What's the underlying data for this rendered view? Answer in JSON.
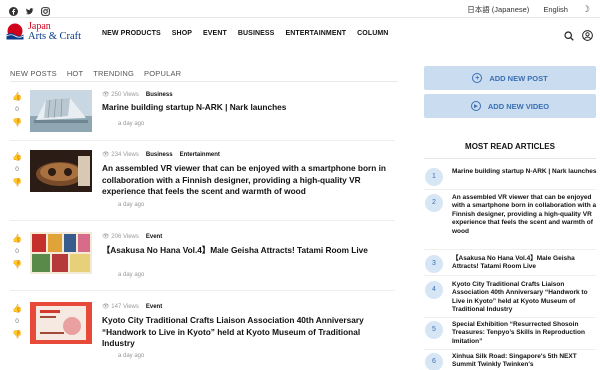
{
  "topbar": {
    "social_icons": [
      "facebook-icon",
      "twitter-icon",
      "instagram-icon"
    ],
    "lang_jp": "日本語 (Japanese)",
    "lang_en": "English"
  },
  "header": {
    "logo_line1": "Japan",
    "logo_line2": "Arts & Craft",
    "nav": [
      "NEW PRODUCTS",
      "SHOP",
      "EVENT",
      "BUSINESS",
      "ENTERTAINMENT",
      "COLUMN"
    ]
  },
  "tabs": [
    "NEW POSTS",
    "HOT",
    "TRENDING",
    "POPULAR"
  ],
  "articles": [
    {
      "votes": "0",
      "views": "250 Views",
      "cats": [
        "Business"
      ],
      "title": "Marine building startup N-ARK | Nark launches",
      "ago": "a day ago"
    },
    {
      "votes": "0",
      "views": "234 Views",
      "cats": [
        "Business",
        "Entertainment"
      ],
      "title": "An assembled VR viewer that can be enjoyed with a smartphone born in collaboration with a Finnish designer, providing a high-quality VR experience that feels the scent and warmth of wood",
      "ago": "a day ago"
    },
    {
      "votes": "0",
      "views": "206 Views",
      "cats": [
        "Event"
      ],
      "title": "【Asakusa No Hana Vol.4】Male Geisha Attracts! Tatami Room Live",
      "ago": "a day ago"
    },
    {
      "votes": "0",
      "views": "147 Views",
      "cats": [
        "Event"
      ],
      "title": "Kyoto City Traditional Crafts Liaison Association 40th Anniversary “Handwork to Live in Kyoto” held at Kyoto Museum of Traditional Industry",
      "ago": "a day ago"
    }
  ],
  "sidebar": {
    "add_post": "ADD NEW POST",
    "add_video": "ADD NEW VIDEO",
    "most_read_title": "MOST READ ARTICLES",
    "most_read": [
      {
        "num": "1",
        "text": "Marine building startup N-ARK | Nark launches"
      },
      {
        "num": "2",
        "text": "An assembled VR viewer that can be enjoyed with a smartphone born in collaboration with a Finnish designer, providing a high-quality VR experience that feels the scent and warmth of wood"
      },
      {
        "num": "3",
        "text": "【Asakusa No Hana Vol.4】Male Geisha Attracts! Tatami Room Live"
      },
      {
        "num": "4",
        "text": "Kyoto City Traditional Crafts Liaison Association 40th Anniversary “Handwork to Live in Kyoto” held at Kyoto Museum of Traditional Industry"
      },
      {
        "num": "5",
        "text": "Special Exhibition “Resurrected Shosoin Treasures: Tenpyo’s Skills in Reproduction Imitation”"
      },
      {
        "num": "6",
        "text": "Xinhua Silk Road: Singapore's 5th NEXT Summit Twinkly Twinken's"
      }
    ]
  },
  "colors": {
    "accent": "#3b6fb3",
    "button_bg": "#c9dcf0",
    "logo_red": "#d0021b",
    "logo_blue": "#0a3a8a"
  }
}
